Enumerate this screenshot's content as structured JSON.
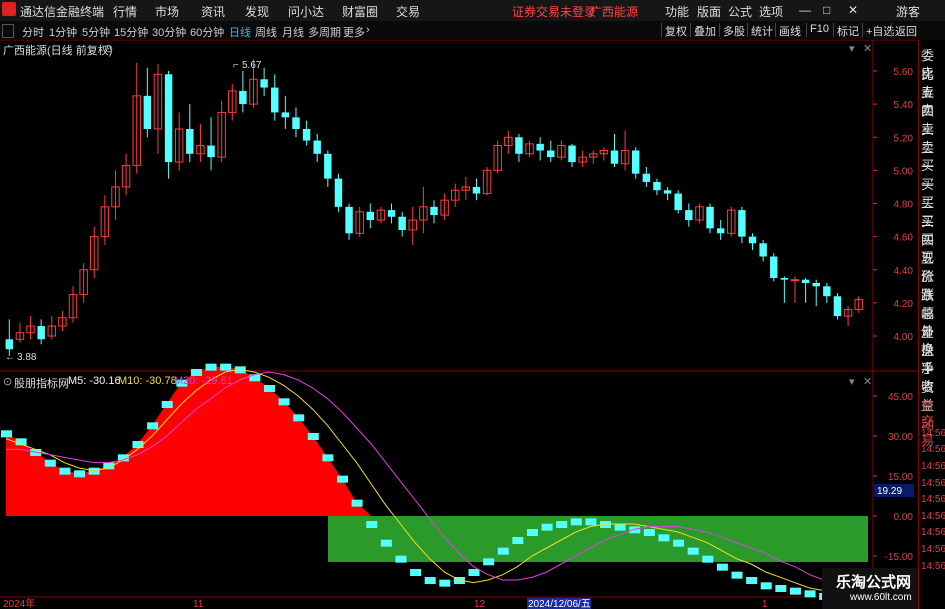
{
  "app": {
    "name": "通达信金融终端",
    "menus": [
      "行情",
      "市场",
      "资讯",
      "发现",
      "问小达",
      "财富圈",
      "交易"
    ],
    "notice": "证券交易未登录",
    "stock_name_top": "广西能源",
    "right_menus": [
      "功能",
      "版面",
      "公式",
      "选项"
    ],
    "window_controls": [
      "—",
      "□",
      "✕"
    ],
    "guest": "游客"
  },
  "timeframes": [
    "分时",
    "1分钟",
    "5分钟",
    "15分钟",
    "30分钟",
    "60分钟",
    "日线",
    "周线",
    "月线",
    "多周期",
    "更多"
  ],
  "timeframe_active": "日线",
  "tools": [
    "复权",
    "叠加",
    "多股",
    "统计",
    "画线",
    "F10",
    "标记",
    "+自选",
    "返回"
  ],
  "main_chart": {
    "title": "广西能源(日线 前复权)",
    "price_axis": [
      "5.60",
      "5.40",
      "5.20",
      "5.00",
      "4.80",
      "4.60",
      "4.40",
      "4.20",
      "4.00"
    ],
    "high_label": "5.67",
    "low_label": "3.88"
  },
  "sub_chart": {
    "name": "股朋指标网",
    "m5_label": "M5: -30.16",
    "m10_label": "M10: -30.78",
    "m20_label": "M20: -29.61",
    "axis": [
      "45.00",
      "30.00",
      "15.00",
      "0.00",
      "-15.00"
    ],
    "current_value": "19.29",
    "m5_color": "#f6f6f6",
    "m10_color": "#f0e020",
    "m20_color": "#e040e0"
  },
  "date_axis": [
    "2024年",
    "11",
    "12",
    "2024/12/06/五",
    "1"
  ],
  "side_panel": [
    "委比",
    "卖五",
    "卖四",
    "卖三",
    "卖二",
    "卖一",
    "买一",
    "买二",
    "买三",
    "买四",
    "买五",
    "现价",
    "涨跌",
    "涨幅",
    "总量",
    "外盘",
    "换手",
    "净资",
    "收益",
    "自动",
    "交易",
    "14:56",
    "14:56",
    "14:56",
    "14:56",
    "14:56",
    "14:56",
    "14:56",
    "14:56",
    "14:56"
  ],
  "watermark": {
    "title": "乐淘公式网",
    "url": "www.60lt.com"
  },
  "chart_data": {
    "type": "candlestick",
    "candles": [
      [
        3.98,
        4.1,
        3.92,
        3.88
      ],
      [
        3.98,
        4.08,
        4.02,
        3.96
      ],
      [
        4.02,
        4.12,
        4.06,
        3.98
      ],
      [
        4.06,
        4.1,
        3.98,
        3.95
      ],
      [
        4.0,
        4.12,
        4.06,
        3.98
      ],
      [
        4.06,
        4.15,
        4.11,
        4.03
      ],
      [
        4.11,
        4.3,
        4.25,
        4.08
      ],
      [
        4.25,
        4.44,
        4.4,
        4.2
      ],
      [
        4.4,
        4.66,
        4.6,
        4.35
      ],
      [
        4.6,
        4.85,
        4.78,
        4.55
      ],
      [
        4.78,
        5.0,
        4.9,
        4.7
      ],
      [
        4.9,
        5.1,
        5.03,
        4.85
      ],
      [
        5.03,
        5.65,
        5.45,
        4.98
      ],
      [
        5.45,
        5.62,
        5.25,
        5.2
      ],
      [
        5.25,
        5.64,
        5.58,
        5.1
      ],
      [
        5.58,
        5.6,
        5.05,
        4.95
      ],
      [
        5.05,
        5.35,
        5.25,
        5.0
      ],
      [
        5.25,
        5.4,
        5.1,
        5.05
      ],
      [
        5.1,
        5.28,
        5.15,
        5.05
      ],
      [
        5.15,
        5.32,
        5.08,
        5.0
      ],
      [
        5.08,
        5.42,
        5.35,
        5.05
      ],
      [
        5.35,
        5.52,
        5.48,
        5.3
      ],
      [
        5.48,
        5.6,
        5.4,
        5.35
      ],
      [
        5.4,
        5.67,
        5.55,
        5.38
      ],
      [
        5.55,
        5.62,
        5.5,
        5.45
      ],
      [
        5.5,
        5.58,
        5.35,
        5.3
      ],
      [
        5.35,
        5.45,
        5.32,
        5.25
      ],
      [
        5.32,
        5.38,
        5.25,
        5.2
      ],
      [
        5.25,
        5.3,
        5.18,
        5.15
      ],
      [
        5.18,
        5.22,
        5.1,
        5.05
      ],
      [
        5.1,
        5.12,
        4.95,
        4.9
      ],
      [
        4.95,
        4.98,
        4.78,
        4.75
      ],
      [
        4.78,
        4.8,
        4.62,
        4.58
      ],
      [
        4.62,
        4.78,
        4.75,
        4.6
      ],
      [
        4.75,
        4.8,
        4.7,
        4.65
      ],
      [
        4.7,
        4.78,
        4.76,
        4.68
      ],
      [
        4.76,
        4.8,
        4.72,
        4.68
      ],
      [
        4.72,
        4.75,
        4.64,
        4.6
      ],
      [
        4.64,
        4.78,
        4.7,
        4.55
      ],
      [
        4.7,
        4.9,
        4.78,
        4.62
      ],
      [
        4.78,
        4.82,
        4.73,
        4.68
      ],
      [
        4.73,
        4.86,
        4.82,
        4.7
      ],
      [
        4.82,
        4.92,
        4.88,
        4.78
      ],
      [
        4.88,
        4.96,
        4.9,
        4.82
      ],
      [
        4.9,
        4.95,
        4.86,
        4.82
      ],
      [
        4.86,
        5.02,
        5.0,
        4.85
      ],
      [
        5.0,
        5.18,
        5.15,
        4.98
      ],
      [
        5.15,
        5.24,
        5.2,
        5.1
      ],
      [
        5.2,
        5.22,
        5.1,
        5.05
      ],
      [
        5.1,
        5.18,
        5.16,
        5.08
      ],
      [
        5.16,
        5.2,
        5.12,
        5.06
      ],
      [
        5.12,
        5.18,
        5.08,
        5.05
      ],
      [
        5.08,
        5.18,
        5.15,
        5.06
      ],
      [
        5.15,
        5.16,
        5.05,
        5.02
      ],
      [
        5.05,
        5.12,
        5.08,
        5.02
      ],
      [
        5.08,
        5.12,
        5.1,
        5.04
      ],
      [
        5.1,
        5.14,
        5.12,
        5.06
      ],
      [
        5.12,
        5.22,
        5.04,
        5.02
      ],
      [
        5.04,
        5.24,
        5.12,
        5.0
      ],
      [
        5.12,
        5.14,
        4.98,
        4.95
      ],
      [
        4.98,
        5.02,
        4.93,
        4.9
      ],
      [
        4.93,
        4.95,
        4.88,
        4.85
      ],
      [
        4.88,
        4.9,
        4.86,
        4.82
      ],
      [
        4.86,
        4.88,
        4.76,
        4.74
      ],
      [
        4.76,
        4.8,
        4.7,
        4.66
      ],
      [
        4.7,
        4.8,
        4.78,
        4.68
      ],
      [
        4.78,
        4.8,
        4.65,
        4.62
      ],
      [
        4.65,
        4.7,
        4.62,
        4.58
      ],
      [
        4.62,
        4.78,
        4.76,
        4.6
      ],
      [
        4.76,
        4.78,
        4.6,
        4.56
      ],
      [
        4.6,
        4.62,
        4.56,
        4.52
      ],
      [
        4.56,
        4.58,
        4.48,
        4.45
      ],
      [
        4.48,
        4.5,
        4.35,
        4.33
      ],
      [
        4.35,
        4.36,
        4.34,
        4.2
      ],
      [
        4.34,
        4.36,
        4.34,
        4.2
      ],
      [
        4.34,
        4.35,
        4.32,
        4.2
      ],
      [
        4.32,
        4.34,
        4.3,
        4.18
      ],
      [
        4.3,
        4.32,
        4.24,
        4.2
      ],
      [
        4.24,
        4.26,
        4.12,
        4.1
      ],
      [
        4.12,
        4.18,
        4.16,
        4.06
      ],
      [
        4.16,
        4.24,
        4.22,
        4.14
      ]
    ],
    "osc": [
      31,
      28,
      24,
      20,
      17,
      16,
      17,
      19,
      22,
      27,
      34,
      42,
      50,
      54,
      56,
      56,
      55,
      52,
      48,
      43,
      37,
      30,
      22,
      14,
      5,
      -3,
      -10,
      -16,
      -21,
      -24,
      -25,
      -24,
      -21,
      -17,
      -13,
      -9,
      -6,
      -4,
      -3,
      -2,
      -2,
      -3,
      -4,
      -5,
      -6,
      -8,
      -10,
      -13,
      -16,
      -19,
      -22,
      -24,
      -26,
      -27,
      -28,
      -29,
      -30,
      -30,
      -30,
      -30
    ],
    "m10": [
      29,
      27,
      25,
      23,
      20,
      18,
      17,
      18,
      21,
      25,
      30,
      36,
      42,
      47,
      51,
      54,
      55,
      54,
      52,
      49,
      45,
      40,
      34,
      27,
      20,
      12,
      4,
      -3,
      -10,
      -16,
      -21,
      -24,
      -25,
      -24,
      -22,
      -19,
      -15,
      -12,
      -9,
      -6,
      -4,
      -3,
      -3,
      -3,
      -4,
      -5,
      -6,
      -8,
      -10,
      -13,
      -16,
      -18,
      -21,
      -23,
      -25,
      -27,
      -28,
      -29,
      -30,
      -31
    ],
    "m20": [
      25,
      25,
      24,
      23,
      22,
      21,
      20,
      20,
      21,
      23,
      26,
      30,
      35,
      40,
      44,
      48,
      51,
      53,
      54,
      53,
      51,
      48,
      44,
      39,
      33,
      27,
      20,
      13,
      6,
      -1,
      -8,
      -14,
      -19,
      -22,
      -24,
      -24,
      -23,
      -21,
      -18,
      -15,
      -12,
      -9,
      -7,
      -5,
      -4,
      -4,
      -4,
      -5,
      -6,
      -8,
      -10,
      -12,
      -14,
      -17,
      -19,
      -22,
      -24,
      -26,
      -28,
      -29.6
    ],
    "price_range": [
      3.8,
      5.8
    ],
    "osc_range": [
      -20,
      60
    ]
  }
}
